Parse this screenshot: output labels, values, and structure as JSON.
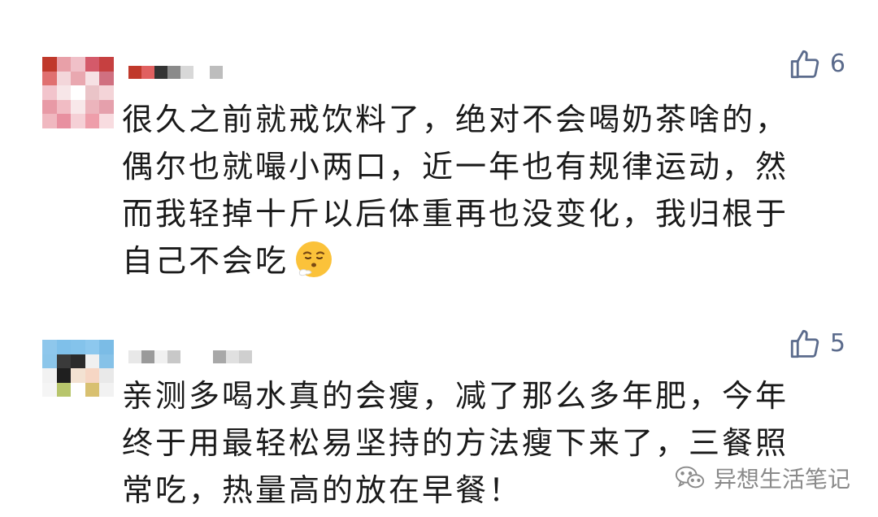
{
  "comments": [
    {
      "like_count": "6",
      "lines": [
        "很久之前就戒饮料了，绝对不会喝奶茶啥的，",
        "偶尔也就嘬小两口，近一年也有规律运动，然",
        "而我轻掉十斤以后体重再也没变化，我归根于",
        "自己不会吃"
      ],
      "emoji": "face-with-steam-emoji"
    },
    {
      "like_count": "5",
      "lines": [
        "亲测多喝水真的会瘦，减了那么多年肥，今年",
        "终于用最轻松易坚持的方法瘦下来了，三餐照",
        "常吃，热量高的放在早餐！"
      ]
    }
  ],
  "watermark": {
    "text": "异想生活笔记",
    "icon": "wechat-icon"
  },
  "colors": {
    "text": "#1a1a1a",
    "like": "#5b6b8c",
    "watermark": "#8a8a8a"
  }
}
